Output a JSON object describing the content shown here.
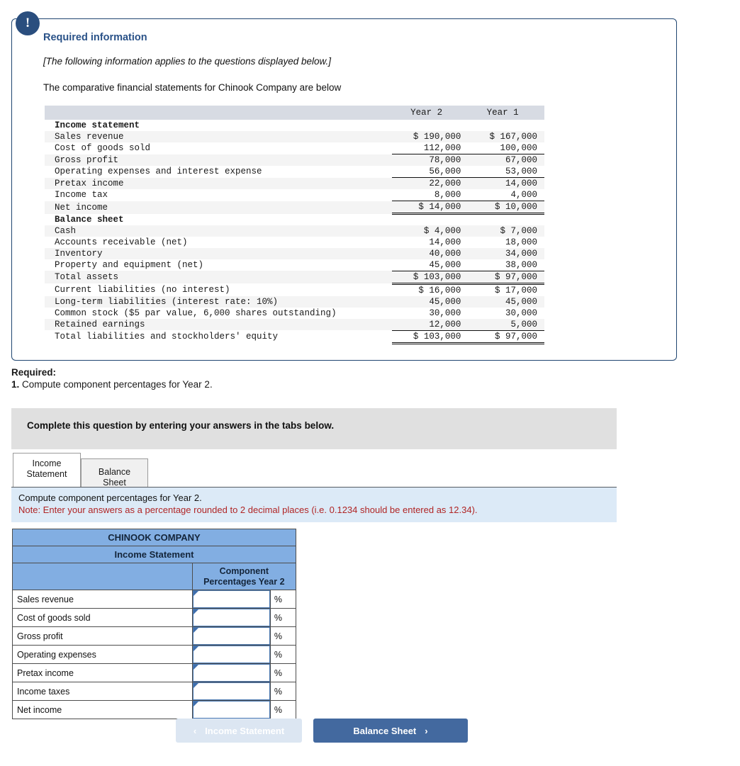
{
  "info_card": {
    "icon": "exclamation-icon",
    "heading": "Required information",
    "italic_note": "[The following information applies to the questions displayed below.]",
    "lead": "The comparative financial statements for Chinook Company are below"
  },
  "financial_statement": {
    "columns": [
      "",
      "Year 2",
      "Year 1"
    ],
    "rows": [
      {
        "label": "Income statement",
        "year2": "",
        "year1": "",
        "style": "section"
      },
      {
        "label": "Sales revenue",
        "year2": "$ 190,000",
        "year1": "$ 167,000",
        "style": "plain"
      },
      {
        "label": "Cost of goods sold",
        "year2": "112,000",
        "year1": "100,000",
        "style": "plain"
      },
      {
        "label": "Gross profit",
        "year2": "78,000",
        "year1": "67,000",
        "style": "topline"
      },
      {
        "label": "Operating expenses and interest expense",
        "year2": "56,000",
        "year1": "53,000",
        "style": "plain"
      },
      {
        "label": "Pretax income",
        "year2": "22,000",
        "year1": "14,000",
        "style": "topline"
      },
      {
        "label": "Income tax",
        "year2": "8,000",
        "year1": "4,000",
        "style": "plain"
      },
      {
        "label": "Net income",
        "year2": "$ 14,000",
        "year1": "$ 10,000",
        "style": "total"
      },
      {
        "label": "Balance sheet",
        "year2": "",
        "year1": "",
        "style": "section"
      },
      {
        "label": "Cash",
        "year2": "$ 4,000",
        "year1": "$ 7,000",
        "style": "plain"
      },
      {
        "label": "Accounts receivable (net)",
        "year2": "14,000",
        "year1": "18,000",
        "style": "plain"
      },
      {
        "label": "Inventory",
        "year2": "40,000",
        "year1": "34,000",
        "style": "plain"
      },
      {
        "label": "Property and equipment (net)",
        "year2": "45,000",
        "year1": "38,000",
        "style": "plain"
      },
      {
        "label": "Total assets",
        "year2": "$ 103,000",
        "year1": "$ 97,000",
        "style": "total"
      },
      {
        "label": "Current liabilities (no interest)",
        "year2": "$ 16,000",
        "year1": "$ 17,000",
        "style": "plain"
      },
      {
        "label": "Long-term liabilities (interest rate: 10%)",
        "year2": "45,000",
        "year1": "45,000",
        "style": "plain"
      },
      {
        "label": "Common stock ($5 par value, 6,000 shares outstanding)",
        "year2": "30,000",
        "year1": "30,000",
        "style": "plain"
      },
      {
        "label": "Retained earnings",
        "year2": "12,000",
        "year1": "5,000",
        "style": "plain"
      },
      {
        "label": "Total liabilities and stockholders' equity",
        "year2": "$ 103,000",
        "year1": "$ 97,000",
        "style": "total"
      }
    ]
  },
  "required": {
    "title": "Required:",
    "number": "1.",
    "text": " Compute component percentages for Year 2."
  },
  "instruction_bar": {
    "text": "Complete this question by entering your answers in the tabs below."
  },
  "tabs": [
    {
      "label": "Income Statement",
      "active": true
    },
    {
      "label": "Balance Sheet",
      "active": false
    }
  ],
  "note_panel": {
    "line1": "Compute component percentages for Year 2.",
    "line2": "Note: Enter your answers as a percentage rounded to 2 decimal places (i.e. 0.1234 should be entered as 12.34)."
  },
  "answer_table": {
    "company": "CHINOOK COMPANY",
    "statement": "Income Statement",
    "col_header": "Component Percentages Year 2",
    "col_header_line1": "Component",
    "col_header_line2": "Percentages Year 2",
    "percent_symbol": "%",
    "rows": [
      {
        "label": "Sales revenue",
        "value": ""
      },
      {
        "label": "Cost of goods sold",
        "value": ""
      },
      {
        "label": "Gross profit",
        "value": ""
      },
      {
        "label": "Operating expenses",
        "value": ""
      },
      {
        "label": "Pretax income",
        "value": ""
      },
      {
        "label": "Income taxes",
        "value": ""
      },
      {
        "label": "Net income",
        "value": ""
      }
    ]
  },
  "nav": {
    "prev_label": "Income Statement",
    "prev_chevron": "‹",
    "next_label": "Balance Sheet",
    "next_chevron": "›"
  },
  "colors": {
    "card_border": "#1f4570",
    "heading_blue": "#2a5288",
    "table_header_gray": "#d7dbe3",
    "answer_header_blue": "#82aee2",
    "note_bg": "#dceaf7",
    "note_red": "#b02525",
    "button_blue": "#43699f",
    "button_disabled": "#dce6f2"
  }
}
